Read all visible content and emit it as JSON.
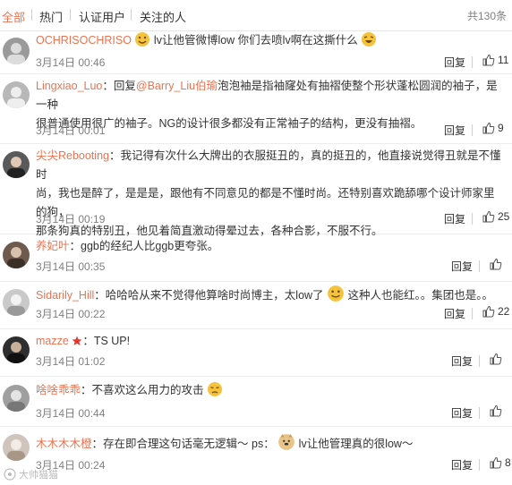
{
  "tabs": {
    "items": [
      {
        "label": "全部"
      },
      {
        "label": "热门"
      },
      {
        "label": "认证用户"
      },
      {
        "label": "关注的人"
      }
    ],
    "total": "共130条"
  },
  "actions": {
    "reply": "回复"
  },
  "comments": [
    {
      "user": "OCHRISOCHRISO",
      "text_a": "lv让他管微博low 你们去喷lv啊在这撕什么",
      "time": "3月14日 00:46",
      "likes": "11",
      "avatar_color": "#9a9a9a"
    },
    {
      "user": "Lingxiao_Luo",
      "prefix": "：回复",
      "mention": "@Barry_Liu伯瑜",
      "text_a": "泡泡袖是指袖窿处有抽褶使整个形状蓬松圆润的袖子，是一种",
      "text_b": "很普通使用很广的袖子。NG的设计很多都没有正常袖子的结构，更没有抽褶。",
      "time": "3月14日 00:01",
      "likes": "9",
      "avatar_color": "#b8b8b8"
    },
    {
      "user": "尖尖Rebooting",
      "text_a": "：我记得有次什么大牌出的衣服挺丑的，真的挺丑的，他直接说觉得丑就是不懂时",
      "text_b": "尚，我也是醉了，是是是，跟他有不同意见的都是不懂时尚。还特别喜欢跪舔哪个设计师家里的狗，",
      "text_c": "那条狗真的特别丑，他见着简直激动得晕过去，各种合影，不服不行。",
      "time": "3月14日 00:19",
      "likes": "25",
      "avatar_color": "#5a5a5a"
    },
    {
      "user": "养妃叶",
      "text_a": "：ggb的经纪人比ggb更夸张。",
      "time": "3月14日 00:35",
      "likes": "",
      "avatar_color": "#6e5a4e"
    },
    {
      "user": "Sidarily_Hill",
      "text_a": "：哈哈哈从来不觉得他算啥时尚博主，太low了",
      "text_b": "这种人也能红。。集团也是。。",
      "time": "3月14日 00:22",
      "likes": "22",
      "avatar_color": "#c9c9c9"
    },
    {
      "user": "mazze",
      "text_a": "：TS UP!",
      "time": "3月14日 01:02",
      "likes": "",
      "avatar_color": "#2e2e2e"
    },
    {
      "user": "啥啥乖乖",
      "text_a": "：不喜欢这么用力的攻击",
      "time": "3月14日 00:44",
      "likes": "",
      "avatar_color": "#9f9f9f"
    },
    {
      "user": "木木木木橙",
      "text_a": "：存在即合理这句话毫无逻辑～ ps：",
      "text_b": "lv让他管理真的很low～",
      "time": "3月14日 00:24",
      "likes": "8",
      "avatar_color": "#cfc5bd"
    }
  ],
  "watermark": "大帅猫猫",
  "colors": {
    "accent": "#eb7350",
    "meta": "#808080",
    "divider": "#ededed"
  },
  "icons": {
    "like": "thumbs-up-icon",
    "emoji": "smiley-emoji-icon",
    "verified": "star-badge-icon"
  }
}
